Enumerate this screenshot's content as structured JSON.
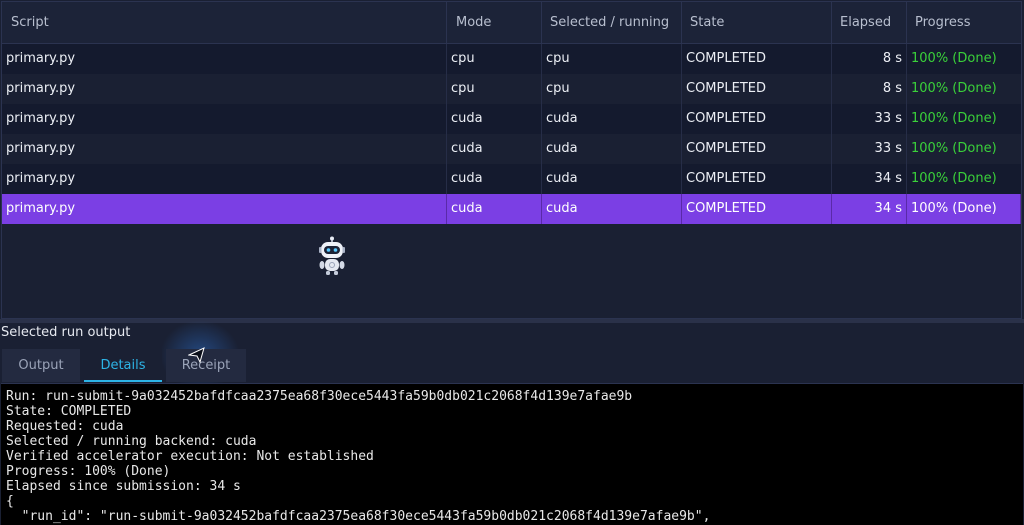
{
  "table": {
    "headers": [
      "Script",
      "Mode",
      "Selected / running",
      "State",
      "Elapsed",
      "Progress"
    ],
    "rows": [
      {
        "script": "primary.py",
        "mode": "cpu",
        "selected": "cpu",
        "state": "COMPLETED",
        "elapsed": "8 s",
        "progress": "100% (Done)"
      },
      {
        "script": "primary.py",
        "mode": "cpu",
        "selected": "cpu",
        "state": "COMPLETED",
        "elapsed": "8 s",
        "progress": "100% (Done)"
      },
      {
        "script": "primary.py",
        "mode": "cuda",
        "selected": "cuda",
        "state": "COMPLETED",
        "elapsed": "33 s",
        "progress": "100% (Done)"
      },
      {
        "script": "primary.py",
        "mode": "cuda",
        "selected": "cuda",
        "state": "COMPLETED",
        "elapsed": "33 s",
        "progress": "100% (Done)"
      },
      {
        "script": "primary.py",
        "mode": "cuda",
        "selected": "cuda",
        "state": "COMPLETED",
        "elapsed": "34 s",
        "progress": "100% (Done)"
      },
      {
        "script": "primary.py",
        "mode": "cuda",
        "selected": "cuda",
        "state": "COMPLETED",
        "elapsed": "34 s",
        "progress": "100% (Done)"
      }
    ],
    "selected_index": 5
  },
  "output_panel": {
    "label": "Selected run output",
    "tabs": [
      "Output",
      "Details",
      "Receipt"
    ],
    "active_tab": "Details",
    "console_lines": [
      "Run: run-submit-9a032452bafdfcaa2375ea68f30ece5443fa59b0db021c2068f4d139e7afae9b",
      "State: COMPLETED",
      "Requested: cuda",
      "Selected / running backend: cuda",
      "Verified accelerator execution: Not established",
      "Progress: 100% (Done)",
      "Elapsed since submission: 34 s",
      "{",
      "  \"run_id\": \"run-submit-9a032452bafdfcaa2375ea68f30ece5443fa59b0db021c2068f4d139e7afae9b\","
    ]
  },
  "colors": {
    "selection": "#7b3fe4",
    "progress_done": "#3ad13a",
    "active_tab": "#2db4e6"
  },
  "icons": [
    "robot-assistant-icon",
    "mouse-cursor-icon"
  ]
}
